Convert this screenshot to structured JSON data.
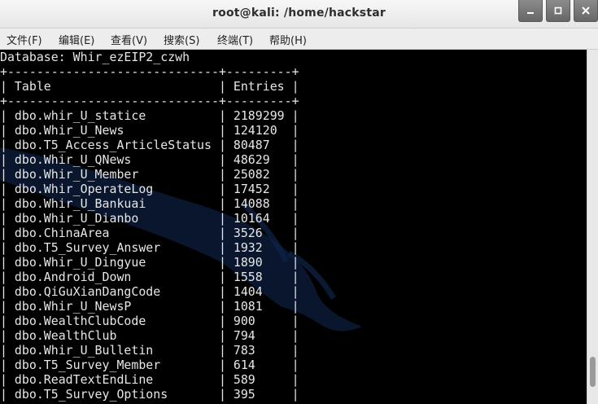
{
  "window": {
    "title": "root@kali: /home/hackstar"
  },
  "menu": [
    "文件(F)",
    "编辑(E)",
    "查看(V)",
    "搜索(S)",
    "终端(T)",
    "帮助(H)"
  ],
  "terminal": {
    "database_line": "Database: Whir_ezEIP2_czwh",
    "border": "+-----------------------------+---------+",
    "header_line": "| Table                       | Entries |",
    "rows": [
      "| dbo.whir_U_statice          | 2189299 |",
      "| dbo.Whir_U_News             | 124120  |",
      "| dbo.T5_Access_ArticleStatus | 80487   |",
      "| dbo.Whir_U_QNews            | 48629   |",
      "| dbo.Whir_U_Member           | 25082   |",
      "| dbo.Whir_OperateLog         | 17452   |",
      "| dbo.Whir_U_Bankuai          | 14088   |",
      "| dbo.Whir_U_Dianbo           | 10164   |",
      "| dbo.ChinaArea               | 3526    |",
      "| dbo.T5_Survey_Answer        | 1932    |",
      "| dbo.Whir_U_Dingyue          | 1890    |",
      "| dbo.Android_Down            | 1558    |",
      "| dbo.QiGuXianDangCode        | 1404    |",
      "| dbo.Whir_U_NewsP            | 1081    |",
      "| dbo.WealthClubCode          | 900     |",
      "| dbo.WealthClub              | 794     |",
      "| dbo.Whir_U_Bulletin         | 783     |",
      "| dbo.T5_Survey_Member        | 614     |",
      "| dbo.ReadTextEndLine         | 589     |",
      "| dbo.T5_Survey_Options       | 395     |"
    ]
  }
}
